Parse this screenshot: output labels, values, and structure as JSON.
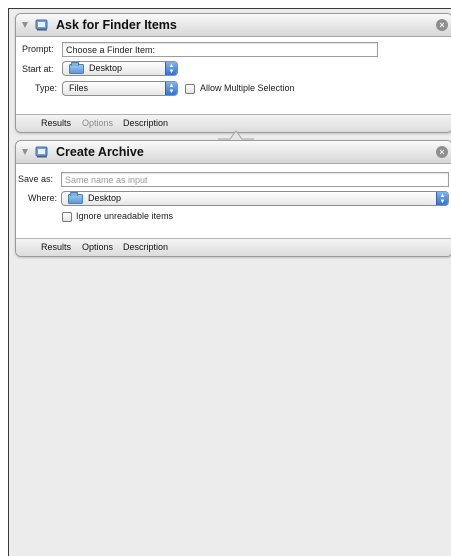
{
  "actions": [
    {
      "title": "Ask for Finder Items",
      "fields": {
        "prompt_label": "Prompt:",
        "prompt_value": "Choose a Finder Item:",
        "start_label": "Start at:",
        "start_value": "Desktop",
        "type_label": "Type:",
        "type_value": "Files",
        "allow_multiple_label": "Allow Multiple Selection",
        "allow_multiple_checked": false
      },
      "tabs": [
        "Results",
        "Options",
        "Description"
      ],
      "enabled_tabs": [
        "Results",
        "Description"
      ]
    },
    {
      "title": "Create Archive",
      "fields": {
        "save_label": "Save as:",
        "save_placeholder": "Same name as input",
        "where_label": "Where:",
        "where_value": "Desktop",
        "ignore_label": "Ignore unreadable items",
        "ignore_checked": false
      },
      "tabs": [
        "Results",
        "Options",
        "Description"
      ],
      "enabled_tabs": [
        "Results",
        "Options",
        "Description"
      ]
    }
  ],
  "colors": {
    "stepper_blue": "#2f74d0",
    "folder_blue": "#5f98d6",
    "workflow_bg": "#ececec"
  },
  "icons": [
    "disclosure-triangle",
    "automator-app-icon",
    "close-icon",
    "folder-icon",
    "popup-stepper-icon",
    "checkbox"
  ]
}
